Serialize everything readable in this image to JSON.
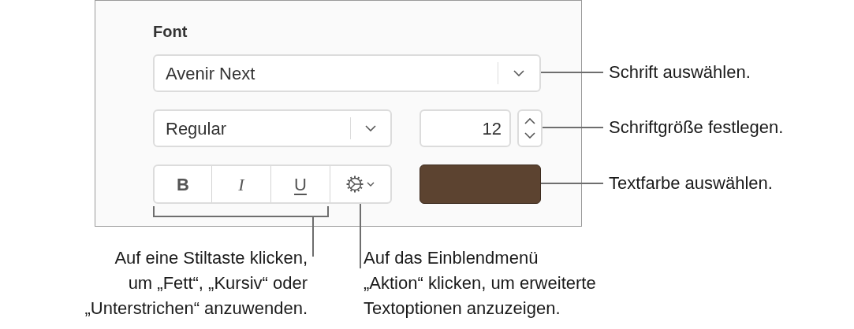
{
  "panel": {
    "title": "Font",
    "font_family": {
      "value": "Avenir Next"
    },
    "typeface": {
      "value": "Regular"
    },
    "size": {
      "value": "12"
    },
    "style_buttons": [
      {
        "kind": "bold",
        "label": "B"
      },
      {
        "kind": "italic",
        "label": "I"
      },
      {
        "kind": "underline",
        "label": "U"
      },
      {
        "kind": "action"
      }
    ],
    "text_color": {
      "color": "#5c4330"
    }
  },
  "callouts": [
    {
      "text": "Schrift auswählen."
    },
    {
      "text": "Schriftgröße festlegen."
    },
    {
      "text": "Textfarbe auswählen."
    }
  ],
  "captions": [
    {
      "text": "Auf eine Stiltaste klicken,\num „Fett“, „Kursiv“ oder\n„Unterstrichen“ anzuwenden."
    },
    {
      "text": "Auf das Einblendmenü\n„Aktion“ klicken, um erweiterte\nTextoptionen anzuzeigen."
    }
  ]
}
